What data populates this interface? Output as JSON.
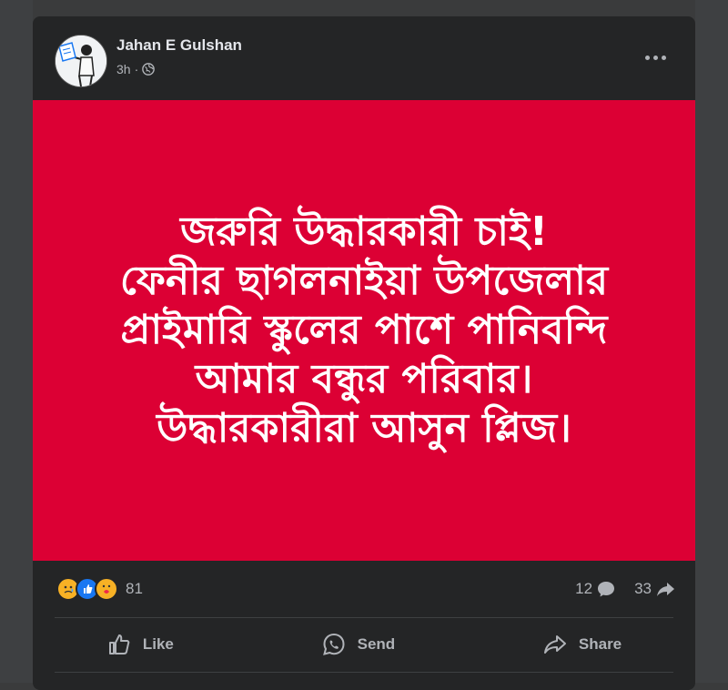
{
  "post": {
    "author": "Jahan E Gulshan",
    "time": "3h",
    "privacy_separator": "·",
    "image_text_lines": [
      "জরুরি উদ্ধারকারী চাই!",
      "ফেনীর ছাগলনাইয়া উপজেলার",
      "প্রাইমারি স্কুলের পাশে পানিবন্দি",
      "আমার বন্ধুর পরিবার।",
      "উদ্ধারকারীরা আসুন প্লিজ।"
    ],
    "image_background": "#dc0034"
  },
  "stats": {
    "reaction_count": "81",
    "reaction_icons": [
      "sad-react-icon",
      "like-react-icon",
      "care-react-icon"
    ],
    "comments": "12",
    "shares": "33"
  },
  "actions": {
    "like": "Like",
    "send": "Send",
    "share": "Share"
  }
}
